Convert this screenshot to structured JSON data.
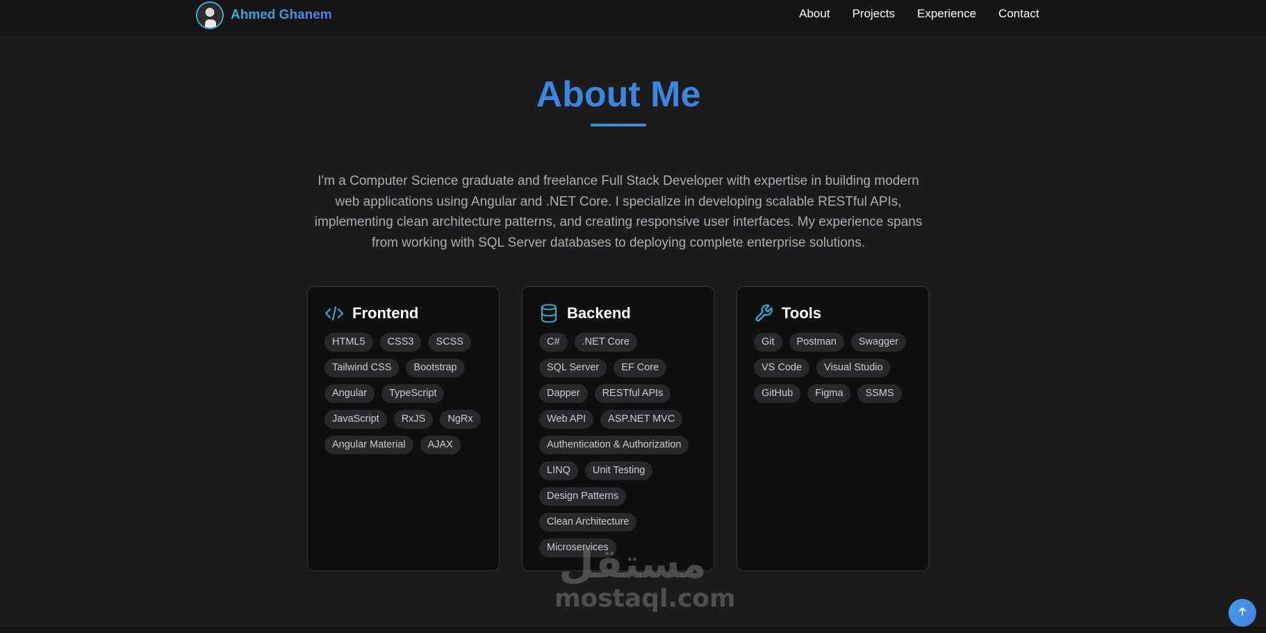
{
  "header": {
    "brand_name": "Ahmed Ghanem",
    "nav": [
      {
        "label": "About"
      },
      {
        "label": "Projects"
      },
      {
        "label": "Experience"
      },
      {
        "label": "Contact"
      }
    ]
  },
  "about": {
    "title": "About Me",
    "description": "I'm a Computer Science graduate and freelance Full Stack Developer with expertise in building modern web applications using Angular and .NET Core. I specialize in developing scalable RESTful APIs, implementing clean architecture patterns, and creating responsive user interfaces. My experience spans from working with SQL Server databases to deploying complete enterprise solutions."
  },
  "skills": [
    {
      "title": "Frontend",
      "icon": "code-icon",
      "tags": [
        "HTML5",
        "CSS3",
        "SCSS",
        "Tailwind CSS",
        "Bootstrap",
        "Angular",
        "TypeScript",
        "JavaScript",
        "RxJS",
        "NgRx",
        "Angular Material",
        "AJAX"
      ]
    },
    {
      "title": "Backend",
      "icon": "database-icon",
      "tags": [
        "C#",
        ".NET Core",
        "SQL Server",
        "EF Core",
        "Dapper",
        "RESTful APIs",
        "Web API",
        "ASP.NET MVC",
        "Authentication & Authorization",
        "LINQ",
        "Unit Testing",
        "Design Patterns",
        "Clean Architecture",
        "Microservices"
      ]
    },
    {
      "title": "Tools",
      "icon": "wrench-icon",
      "tags": [
        "Git",
        "Postman",
        "Swagger",
        "VS Code",
        "Visual Studio",
        "GitHub",
        "Figma",
        "SSMS"
      ]
    }
  ],
  "watermark": {
    "arabic": "مستقل",
    "latin": "mostaql.com"
  },
  "scroll_top": {
    "icon": "arrow-up-icon"
  },
  "colors": {
    "accent": "#3c86e0",
    "accent_cyan": "#3ba8d8",
    "background": "#1c1c1d",
    "card_bg": "#0f0f10",
    "tag_bg": "#29292b"
  }
}
